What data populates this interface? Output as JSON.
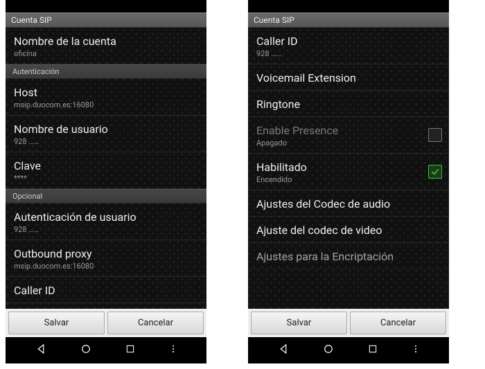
{
  "left": {
    "titlebar": "Cuenta SIP",
    "items": [
      {
        "type": "item",
        "title": "Nombre de la cuenta",
        "sub": "oficina"
      },
      {
        "type": "header",
        "label": "Autenticación"
      },
      {
        "type": "item",
        "title": "Host",
        "sub": "msip.duocom.es:16080"
      },
      {
        "type": "item",
        "title": "Nombre de usuario",
        "sub": "928 ……"
      },
      {
        "type": "item",
        "title": "Clave",
        "sub": "****"
      },
      {
        "type": "header",
        "label": "Opcional"
      },
      {
        "type": "item",
        "title": "Autenticación de usuario",
        "sub": "928 ……"
      },
      {
        "type": "item",
        "title": "Outbound proxy",
        "sub": "msip.duocom.es:16080"
      },
      {
        "type": "item",
        "title": "Caller ID",
        "sub": ""
      }
    ],
    "buttons": {
      "save": "Salvar",
      "cancel": "Cancelar"
    }
  },
  "right": {
    "titlebar": "Cuenta SIP",
    "items": [
      {
        "type": "item",
        "title": "Caller ID",
        "sub": "928 ……"
      },
      {
        "type": "item",
        "title": "Voicemail Extension",
        "sub": ""
      },
      {
        "type": "item",
        "title": "Ringtone",
        "sub": ""
      },
      {
        "type": "toggle",
        "title": "Enable Presence",
        "sub": "Apagado",
        "checked": false,
        "disabled": true
      },
      {
        "type": "toggle",
        "title": "Habilitado",
        "sub": "Encendido",
        "checked": true,
        "disabled": false
      },
      {
        "type": "item",
        "title": "Ajustes del Codec de audio",
        "sub": ""
      },
      {
        "type": "item",
        "title": "Ajuste del codec de video",
        "sub": ""
      },
      {
        "type": "item",
        "title": "Ajustes para la Encriptación",
        "sub": "",
        "cut": true
      }
    ],
    "buttons": {
      "save": "Salvar",
      "cancel": "Cancelar"
    }
  }
}
